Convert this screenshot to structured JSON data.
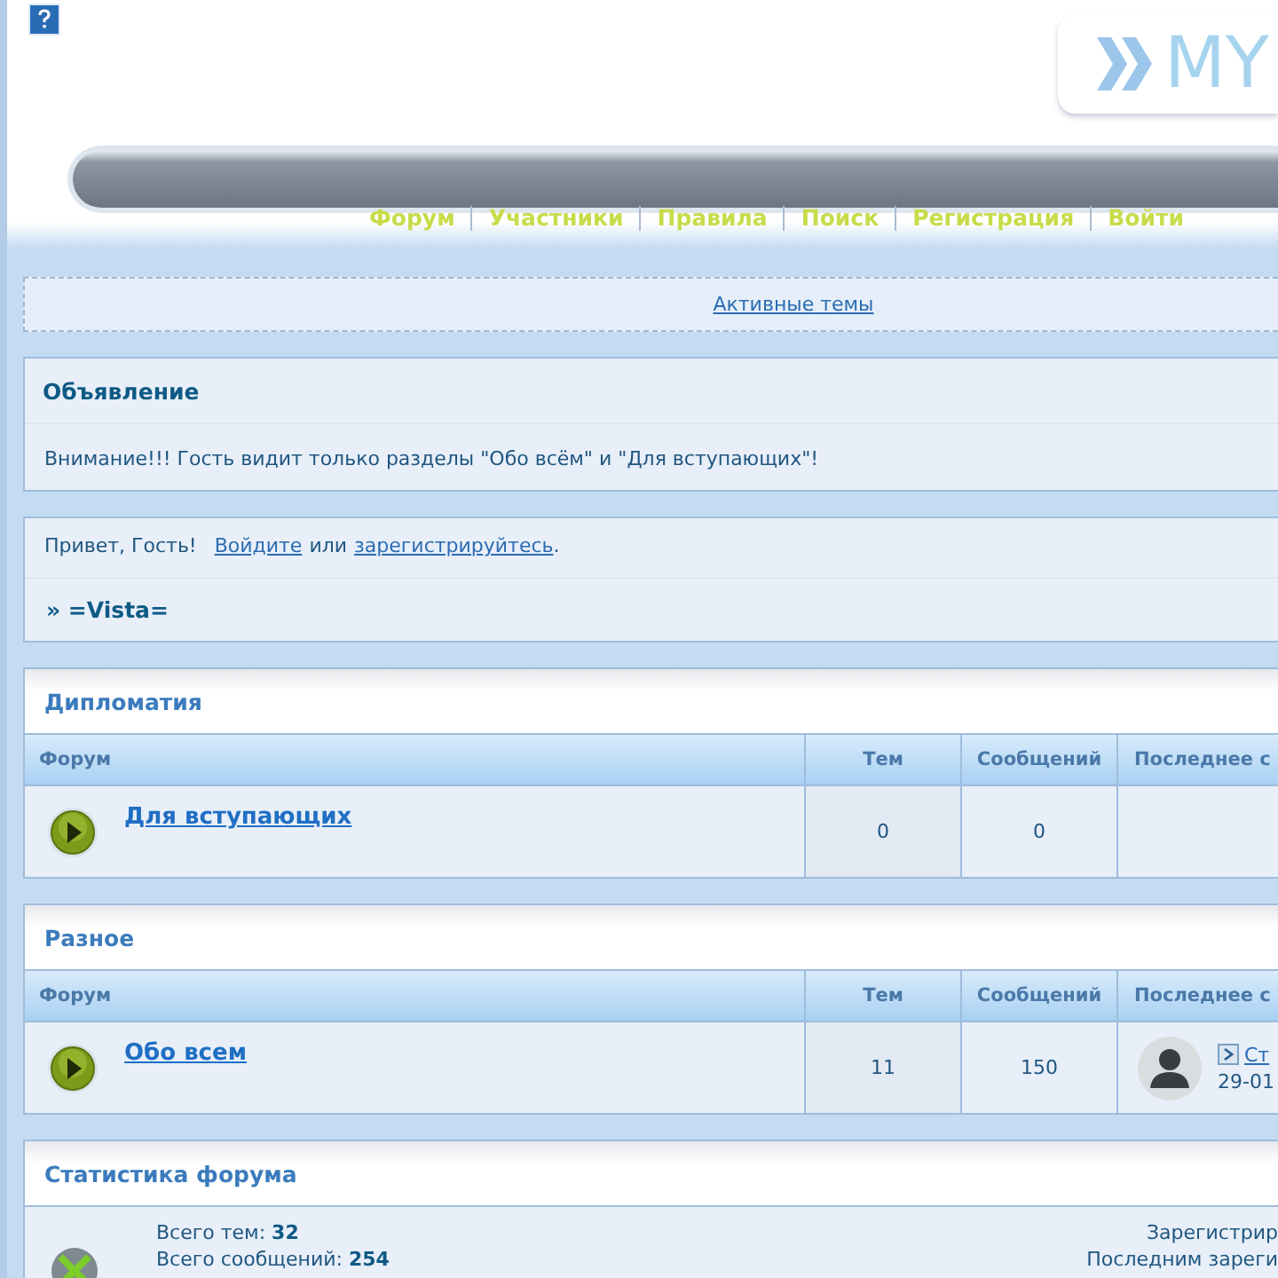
{
  "header": {
    "logo_text": "MY",
    "nav": [
      "Форум",
      "Участники",
      "Правила",
      "Поиск",
      "Регистрация",
      "Войти"
    ]
  },
  "active_topics_link": "Активные темы",
  "announcement": {
    "title": "Объявление",
    "text": "Внимание!!! Гость видит только разделы \"Обо всём\" и \"Для вступающих\"!"
  },
  "greeting": {
    "text": "Привет, Гость!",
    "login_link": "Войдите",
    "or": "или",
    "register_link": "зарегистрируйтесь",
    "dot": ".",
    "breadcrumb": "» =Vista="
  },
  "categories": [
    {
      "title": "Дипломатия",
      "columns": [
        "Форум",
        "Тем",
        "Сообщений",
        "Последнее с"
      ],
      "rows": [
        {
          "name": "Для вступающих",
          "topics": "0",
          "posts": "0",
          "last_post": null
        }
      ]
    },
    {
      "title": "Разное",
      "columns": [
        "Форум",
        "Тем",
        "Сообщений",
        "Последнее с"
      ],
      "rows": [
        {
          "name": "Обо всем",
          "topics": "11",
          "posts": "150",
          "last_post": {
            "title": "Ст",
            "date": "29-01"
          }
        }
      ]
    }
  ],
  "stats": {
    "title": "Статистика форума",
    "left": [
      "Всего тем: **32**",
      "Всего сообщений: **254**"
    ],
    "right": [
      "Зарегистрир",
      "Последним зареги"
    ]
  }
}
